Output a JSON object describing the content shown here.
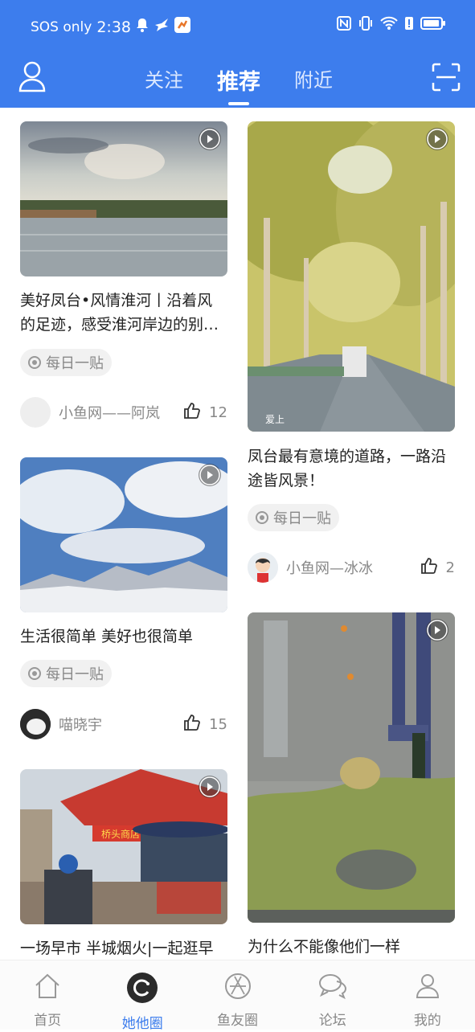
{
  "status_bar": {
    "carrier": "SOS only",
    "time": "2:38"
  },
  "header": {
    "tabs": [
      "关注",
      "推荐",
      "附近"
    ],
    "active_tab": "推荐"
  },
  "feed": {
    "left": [
      {
        "title": "美好凤台•风情淮河丨沿着风的足迹，感受淮河岸边的别…",
        "tag": "每日一贴",
        "author": "小鱼网——阿岚",
        "likes": "12"
      },
      {
        "title": "生活很简单 美好也很简单",
        "tag": "每日一贴",
        "author": "喵晓宇",
        "likes": "15"
      },
      {
        "title": "一场早市 半城烟火|一起逛早"
      }
    ],
    "right": [
      {
        "title": "凤台最有意境的道路，一路沿途皆风景！",
        "tag": "每日一贴",
        "author": "小鱼网—冰冰",
        "likes": "2",
        "watermark": "爱上"
      },
      {
        "title": "为什么不能像他们一样"
      }
    ]
  },
  "market_sign": "桥头商店",
  "bottom_nav": [
    {
      "label": "首页",
      "icon": "home-icon"
    },
    {
      "label": "她他圈",
      "icon": "circle-icon",
      "active": true
    },
    {
      "label": "鱼友圈",
      "icon": "aperture-icon"
    },
    {
      "label": "论坛",
      "icon": "chat-bubble-icon"
    },
    {
      "label": "我的",
      "icon": "person-icon"
    }
  ],
  "colors": {
    "brand": "#3d7ded",
    "muted": "#888888",
    "text": "#222222"
  }
}
